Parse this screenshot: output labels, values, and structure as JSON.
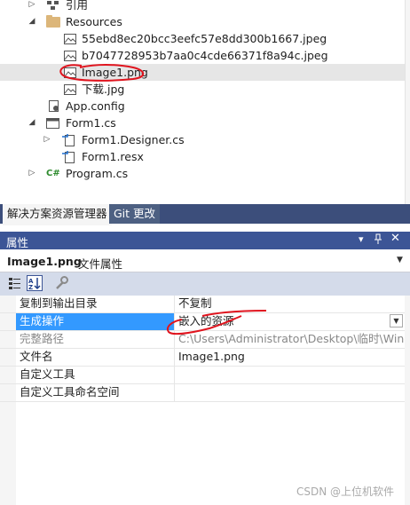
{
  "tree": {
    "items": [
      {
        "label": "引用",
        "icon": "references-icon",
        "expand": "collapsed",
        "indent": 0
      },
      {
        "label": "Resources",
        "icon": "folder-icon",
        "expand": "expanded",
        "indent": 0
      },
      {
        "label": "55ebd8ec20bcc3eefc57e8dd300b1667.jpeg",
        "icon": "image-file-icon",
        "expand": "none",
        "indent": 1
      },
      {
        "label": "b7047728953b7aa0c4cde66371f8a94c.jpeg",
        "icon": "image-file-icon",
        "expand": "none",
        "indent": 1
      },
      {
        "label": "Image1.png",
        "icon": "image-file-icon",
        "expand": "none",
        "indent": 1,
        "selected": true
      },
      {
        "label": "下载.jpg",
        "icon": "image-file-icon",
        "expand": "none",
        "indent": 1
      },
      {
        "label": "App.config",
        "icon": "config-file-icon",
        "expand": "none",
        "indent": 0
      },
      {
        "label": "Form1.cs",
        "icon": "form-file-icon",
        "expand": "expanded",
        "indent": 0
      },
      {
        "label": "Form1.Designer.cs",
        "icon": "cs-file-icon",
        "expand": "collapsed",
        "indent": 1
      },
      {
        "label": "Form1.resx",
        "icon": "resx-file-icon",
        "expand": "none",
        "indent": 1
      },
      {
        "label": "Program.cs",
        "icon": "csharp-file-icon",
        "expand": "collapsed",
        "indent": 0
      }
    ]
  },
  "tabs": [
    {
      "label": "解决方案资源管理器",
      "active": true
    },
    {
      "label": "Git 更改",
      "active": false
    }
  ],
  "properties": {
    "title": "属性",
    "object_name": "Image1.png",
    "object_type": "文件属性",
    "rows": [
      {
        "name": "复制到输出目录",
        "value": "不复制"
      },
      {
        "name": "生成操作",
        "value": "嵌入的资源",
        "selected": true
      },
      {
        "name": "完整路径",
        "value": "C:\\Users\\Administrator\\Desktop\\临时\\Windo",
        "dim": true
      },
      {
        "name": "文件名",
        "value": "Image1.png"
      },
      {
        "name": "自定义工具",
        "value": ""
      },
      {
        "name": "自定义工具命名空间",
        "value": ""
      }
    ]
  },
  "watermark": "CSDN @上位机软件",
  "colors": {
    "header_bg": "#3c5596",
    "tab_strip_bg": "#3c4e7b",
    "selection_blue": "#3399ff",
    "annotation_red": "#e0141e"
  }
}
